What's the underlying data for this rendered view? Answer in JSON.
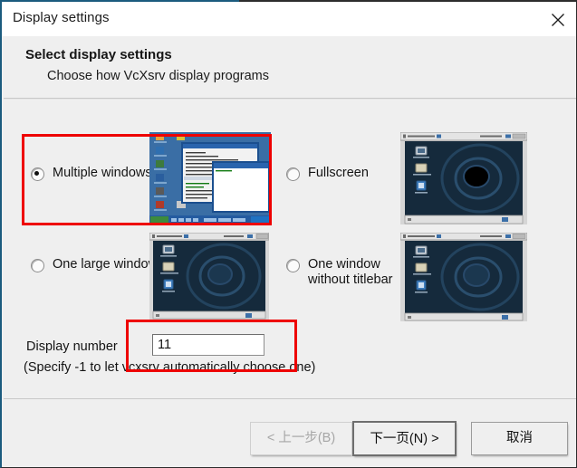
{
  "window": {
    "title": "Display settings",
    "close_icon": "close-icon"
  },
  "header": {
    "title": "Select display settings",
    "subtitle": "Choose how VcXsrv display programs"
  },
  "options": [
    {
      "id": "multiple",
      "label": "Multiple windows",
      "selected": true,
      "preview": "windows-xp-desktop-multiple-windows",
      "highlighted": true
    },
    {
      "id": "fullscreen",
      "label": "Fullscreen",
      "selected": false,
      "preview": "debian-desktop-fullscreen",
      "highlighted": false
    },
    {
      "id": "onelarge",
      "label": "One large window",
      "selected": false,
      "preview": "debian-desktop-one-large-window",
      "highlighted": false
    },
    {
      "id": "notitlebar",
      "label": "One window\nwithout titlebar",
      "selected": false,
      "preview": "debian-desktop-no-titlebar",
      "highlighted": false
    }
  ],
  "display_number": {
    "label": "Display number",
    "value": "11",
    "hint": "(Specify -1 to let vcxsrv automatically choose one)"
  },
  "footer": {
    "back_label": "< 上一步(B)",
    "back_accel": "B",
    "next_label": "下一页(N) >",
    "next_accel": "N",
    "cancel_label": "取消",
    "back_disabled": true,
    "next_default": true
  },
  "colors": {
    "window_border": "#1b5b7e",
    "dialog_bg": "#efefef",
    "titlebar_bg": "#ffffff",
    "annotation_red": "#ee0000",
    "text": "#141414",
    "disabled_text": "#a6a6a6",
    "debian_desktop": "#152a3c",
    "xp_desktop": "#3a6ea5"
  },
  "annotations": [
    {
      "name": "multiple-windows-highlight",
      "target": "multiple"
    },
    {
      "name": "display-number-highlight",
      "target": "display_number"
    }
  ]
}
